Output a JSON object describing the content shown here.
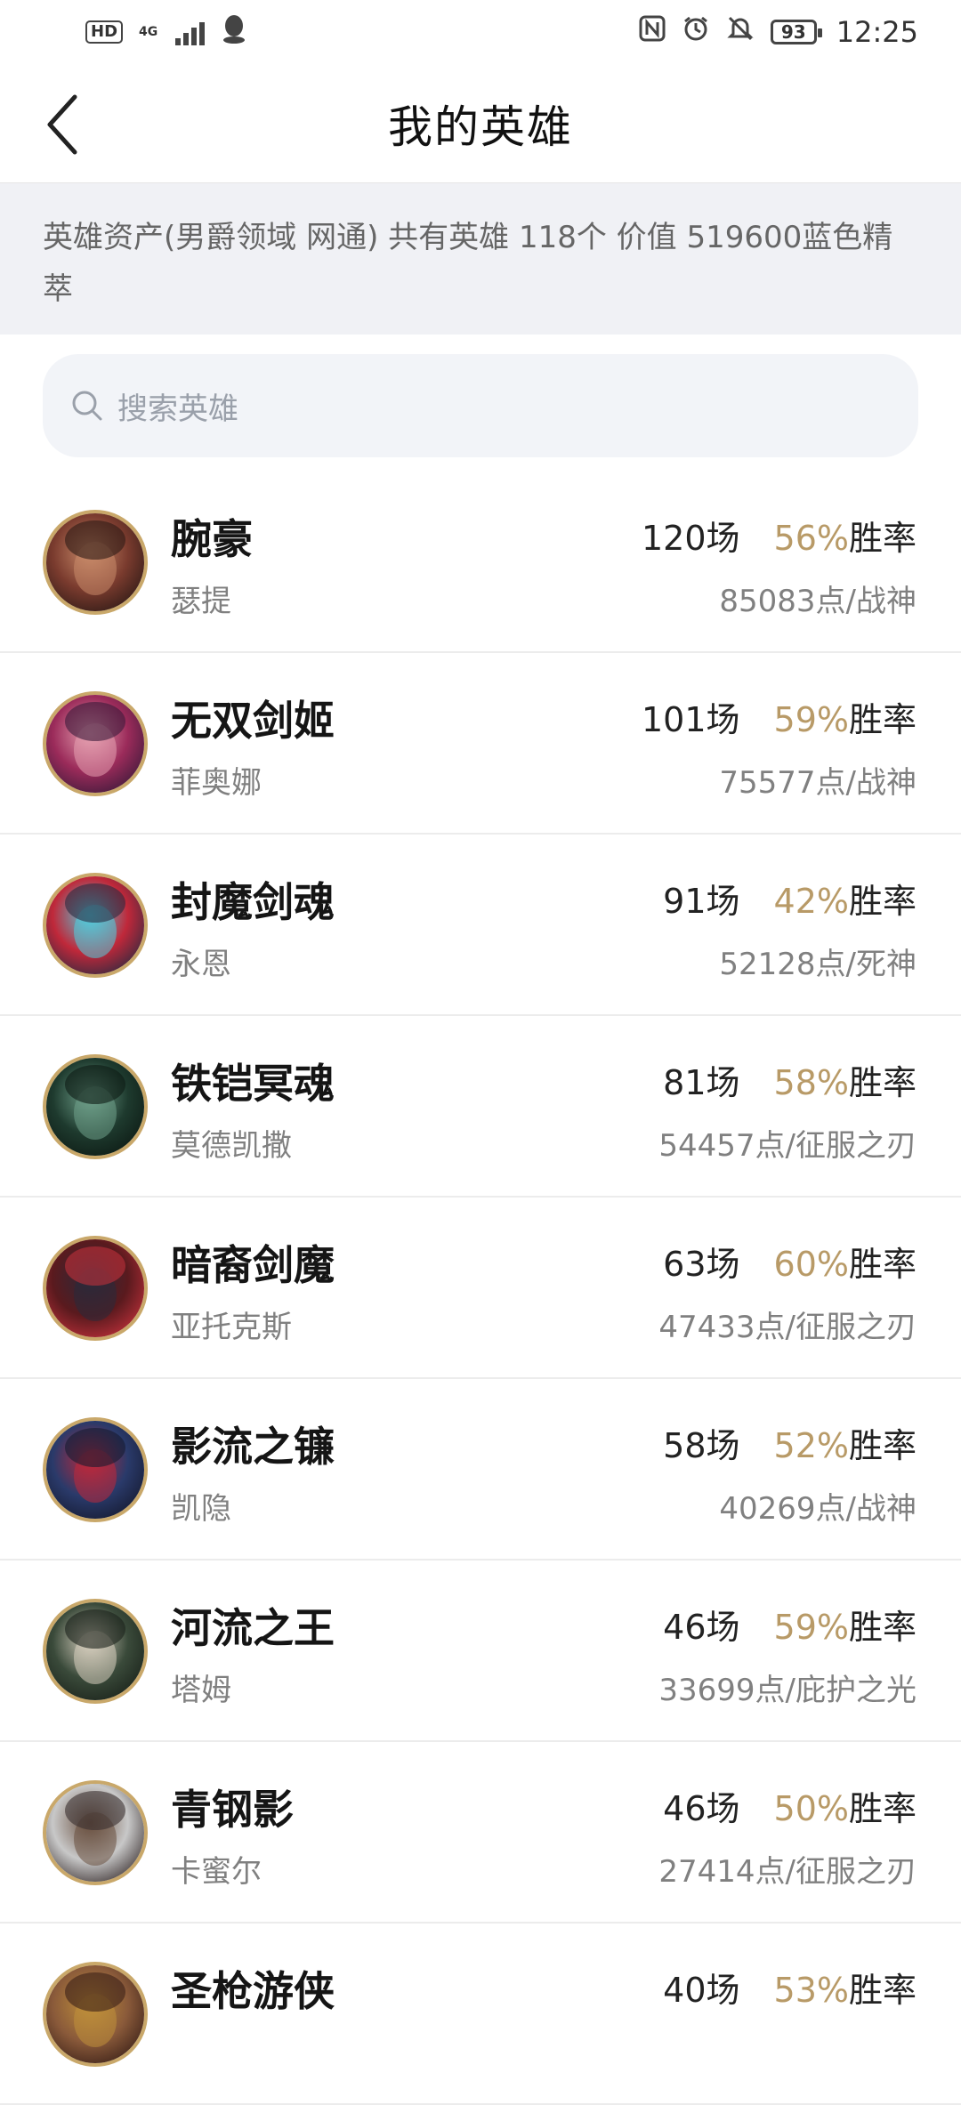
{
  "status_bar": {
    "hd": "HD",
    "network": "4G",
    "battery": "93",
    "time": "12:25"
  },
  "header": {
    "title": "我的英雄"
  },
  "summary": {
    "text": "英雄资产(男爵领域 网通) 共有英雄 118个 价值 519600蓝色精萃"
  },
  "search": {
    "placeholder": "搜索英雄"
  },
  "heroes": [
    {
      "title": "腕豪",
      "name": "瑟提",
      "games": "120场",
      "winrate": "56%",
      "winrate_label": "胜率",
      "points": "85083点/战神",
      "colors": [
        "#7a3b2e",
        "#c98b6a",
        "#2d1a16"
      ]
    },
    {
      "title": "无双剑姬",
      "name": "菲奥娜",
      "games": "101场",
      "winrate": "59%",
      "winrate_label": "胜率",
      "points": "75577点/战神",
      "colors": [
        "#9b2b5a",
        "#e6a0b0",
        "#3b1a3a"
      ]
    },
    {
      "title": "封魔剑魂",
      "name": "永恩",
      "games": "91场",
      "winrate": "42%",
      "winrate_label": "胜率",
      "points": "52128点/死神",
      "colors": [
        "#c0283a",
        "#4fd0e0",
        "#2a2a40"
      ]
    },
    {
      "title": "铁铠冥魂",
      "name": "莫德凯撒",
      "games": "81场",
      "winrate": "58%",
      "winrate_label": "胜率",
      "points": "54457点/征服之刃",
      "colors": [
        "#1e3a2e",
        "#6fa08a",
        "#0d1a14"
      ]
    },
    {
      "title": "暗裔剑魔",
      "name": "亚托克斯",
      "games": "63场",
      "winrate": "60%",
      "winrate_label": "胜率",
      "points": "47433点/征服之刃",
      "colors": [
        "#5a1a1e",
        "#2a2a3a",
        "#c0303a"
      ]
    },
    {
      "title": "影流之镰",
      "name": "凯隐",
      "games": "58场",
      "winrate": "52%",
      "winrate_label": "胜率",
      "points": "40269点/战神",
      "colors": [
        "#2a3a6a",
        "#c0283a",
        "#151a30"
      ]
    },
    {
      "title": "河流之王",
      "name": "塔姆",
      "games": "46场",
      "winrate": "59%",
      "winrate_label": "胜率",
      "points": "33699点/庇护之光",
      "colors": [
        "#3a4a3a",
        "#d8d0c0",
        "#1a221a"
      ]
    },
    {
      "title": "青钢影",
      "name": "卡蜜尔",
      "games": "46场",
      "winrate": "50%",
      "winrate_label": "胜率",
      "points": "27414点/征服之刃",
      "colors": [
        "#c8c8c8",
        "#6a5040",
        "#3a3030"
      ]
    },
    {
      "title": "圣枪游侠",
      "name": "",
      "games": "40场",
      "winrate": "53%",
      "winrate_label": "胜率",
      "points": "",
      "colors": [
        "#8a5a3a",
        "#c0903a",
        "#3a2018"
      ]
    }
  ]
}
